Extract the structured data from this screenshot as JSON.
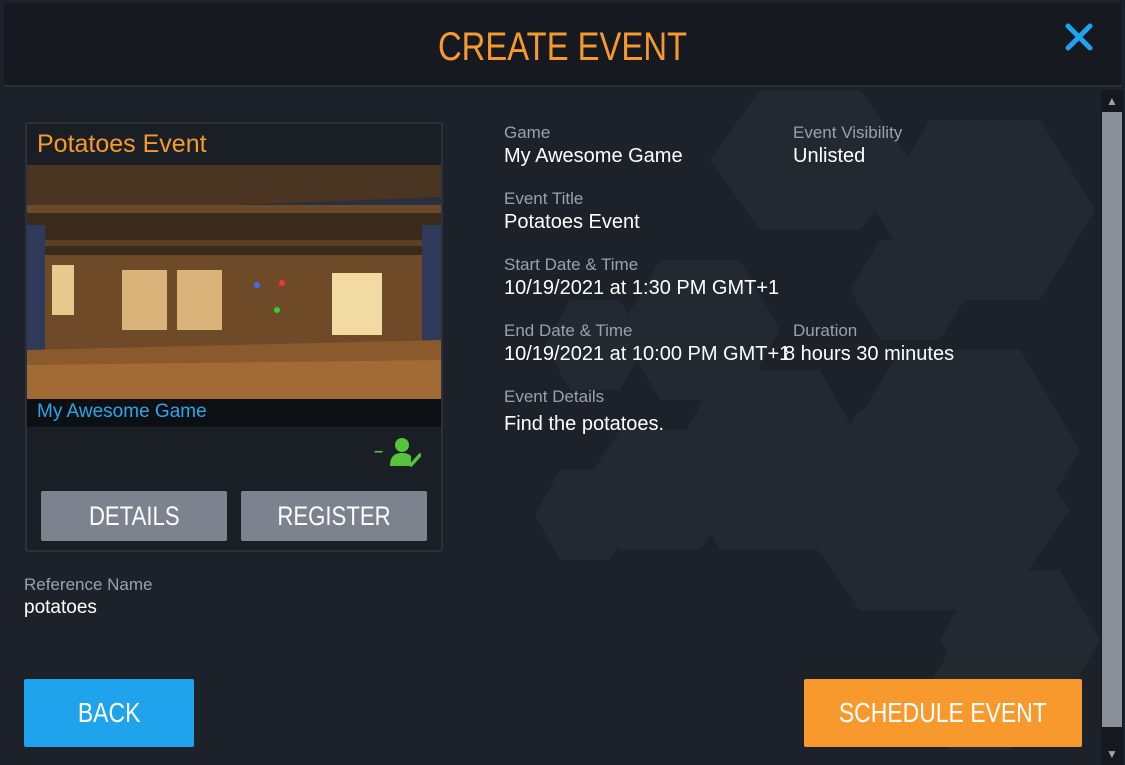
{
  "header": {
    "title": "CREATE EVENT"
  },
  "card": {
    "title": "Potatoes Event",
    "game_link": "My Awesome Game",
    "registration_dash": "–",
    "buttons": {
      "details": "DETAILS",
      "register": "REGISTER"
    }
  },
  "reference": {
    "label": "Reference Name",
    "value": "potatoes"
  },
  "fields": {
    "game": {
      "label": "Game",
      "value": "My Awesome Game"
    },
    "visibility": {
      "label": "Event Visibility",
      "value": "Unlisted"
    },
    "event_title": {
      "label": "Event Title",
      "value": "Potatoes Event"
    },
    "start": {
      "label": "Start Date & Time",
      "value": "10/19/2021 at 1:30 PM GMT+1"
    },
    "end": {
      "label": "End Date & Time",
      "value": "10/19/2021 at 10:00 PM GMT+1"
    },
    "duration": {
      "label": "Duration",
      "value": "8 hours 30 minutes"
    },
    "details": {
      "label": "Event Details",
      "value": "Find the potatoes."
    }
  },
  "footer": {
    "back": "BACK",
    "schedule": "SCHEDULE EVENT"
  },
  "colors": {
    "accent": "#f7992c",
    "link": "#2fa4e7",
    "back_button": "#1ea3ec",
    "success": "#55c43a"
  }
}
